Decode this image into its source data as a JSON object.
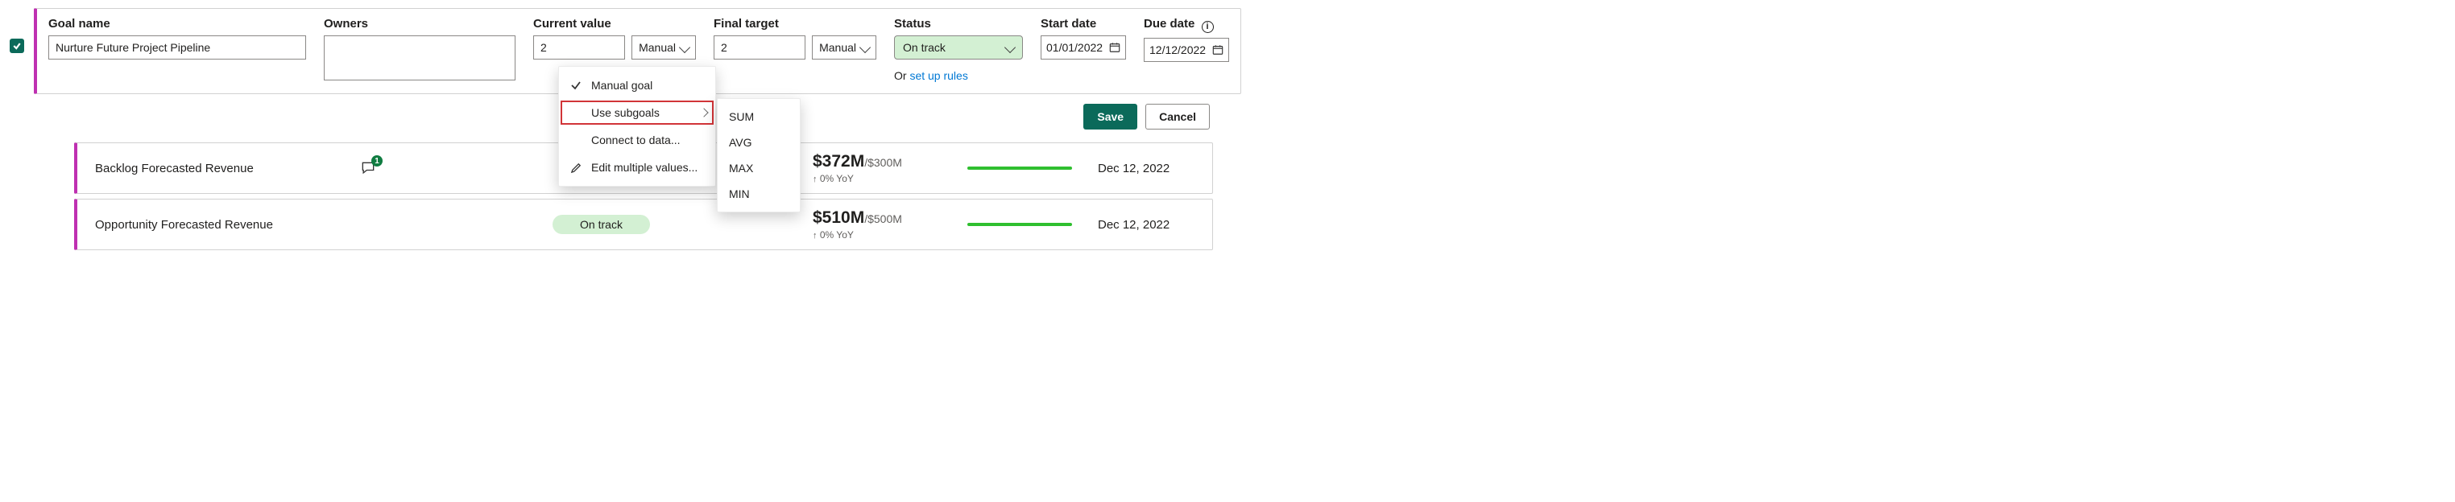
{
  "form": {
    "goal_name_label": "Goal name",
    "goal_name_value": "Nurture Future Project Pipeline",
    "owners_label": "Owners",
    "current_value_label": "Current value",
    "current_value_value": "2",
    "current_value_mode": "Manual",
    "final_target_label": "Final target",
    "final_target_value": "2",
    "final_target_mode": "Manual",
    "status_label": "Status",
    "status_value": "On track",
    "status_or_prefix": "Or ",
    "status_link": "set up rules",
    "start_date_label": "Start date",
    "start_date_value": "01/01/2022",
    "due_date_label": "Due date",
    "due_date_value": "12/12/2022"
  },
  "menu": {
    "items": [
      {
        "label": "Manual goal",
        "icon": "check"
      },
      {
        "label": "Use subgoals",
        "icon": "",
        "submenu": true,
        "highlight": true
      },
      {
        "label": "Connect to data...",
        "icon": ""
      },
      {
        "label": "Edit multiple values...",
        "icon": "pencil"
      }
    ],
    "sub": [
      "SUM",
      "AVG",
      "MAX",
      "MIN"
    ]
  },
  "actions": {
    "save": "Save",
    "cancel": "Cancel"
  },
  "goals": [
    {
      "name": "Backlog Forecasted Revenue",
      "comments_badge": "1",
      "status": "",
      "value_main": "$372M",
      "value_target": "/$300M",
      "delta": "0% YoY",
      "due": "Dec 12, 2022"
    },
    {
      "name": "Opportunity Forecasted Revenue",
      "comments_badge": "",
      "status": "On track",
      "value_main": "$510M",
      "value_target": "/$500M",
      "delta": "0% YoY",
      "due": "Dec 12, 2022"
    }
  ]
}
